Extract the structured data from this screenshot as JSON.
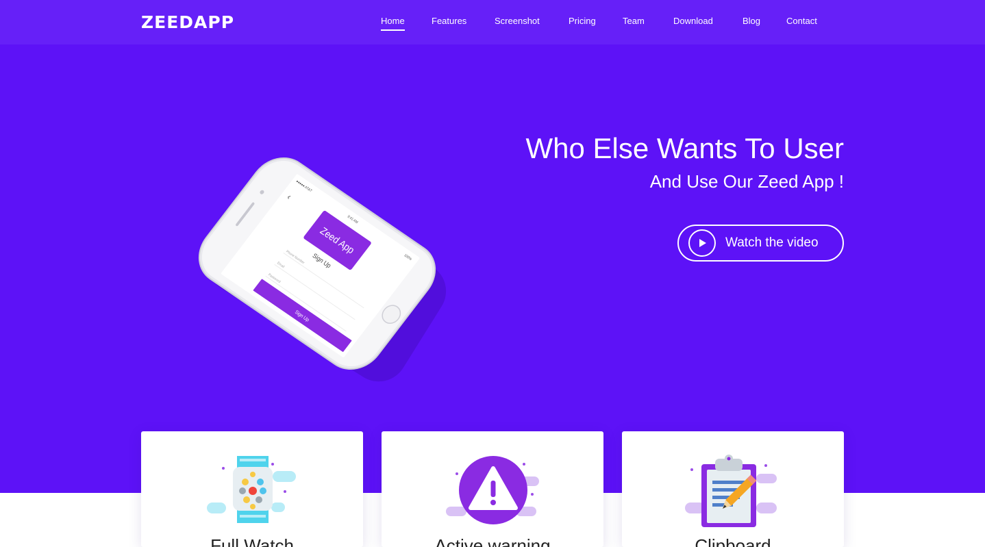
{
  "brand": {
    "logo": "ZEEDAPP"
  },
  "nav": {
    "items": [
      {
        "label": "Home",
        "active": true
      },
      {
        "label": "Features"
      },
      {
        "label": "Screenshot"
      },
      {
        "label": "Pricing"
      },
      {
        "label": "Team"
      },
      {
        "label": "Download"
      },
      {
        "label": "Blog"
      },
      {
        "label": "Contact"
      }
    ]
  },
  "hero": {
    "title": "Who Else Wants To User",
    "subtitle": "And Use Our Zeed App !",
    "video_button": "Watch the video",
    "phone_screen": {
      "status_carrier": "●●●●● AT&T",
      "status_time": "9:41 AM",
      "status_battery": "100%",
      "app_badge": "Zeed App",
      "heading": "Sign Up",
      "phone_placeholder": "Phone Number",
      "email_placeholder": "Email",
      "password_placeholder": "Password",
      "submit_label": "Sign Up"
    }
  },
  "cards": [
    {
      "icon": "watch-icon",
      "title": "Full Watch"
    },
    {
      "icon": "warning-icon",
      "title": "Active warning"
    },
    {
      "icon": "clipboard-icon",
      "title": "Clipboard"
    }
  ],
  "colors": {
    "hero_bg": "#5d12f7",
    "navbar_bg": "#6620f8",
    "accent": "#8a2be2",
    "card_bg": "#ffffff"
  }
}
